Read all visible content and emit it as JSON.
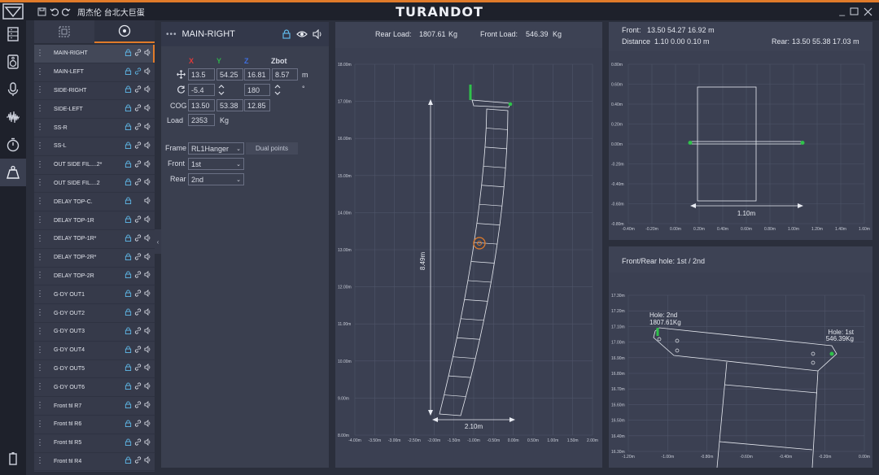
{
  "app": {
    "brand": "TURANDOT",
    "project_title": "周杰伦 台北大巨蛋"
  },
  "rail": {
    "items": [
      "speaker-stack-icon",
      "speaker-icon",
      "microphone-icon",
      "waveform-icon",
      "timer-icon",
      "weight-icon"
    ],
    "active_index": 5,
    "bottom_icon": "battery-icon"
  },
  "list": {
    "selected_index": 0,
    "items": [
      {
        "label": "MAIN-RIGHT",
        "lock": true,
        "link": true,
        "sound": true,
        "link_highlight": false
      },
      {
        "label": "MAIN-LEFT",
        "lock": true,
        "link": true,
        "sound": true,
        "link_highlight": true
      },
      {
        "label": "SIDE-RIGHT",
        "lock": true,
        "link": true,
        "sound": true,
        "link_highlight": false
      },
      {
        "label": "SIDE-LEFT",
        "lock": true,
        "link": true,
        "sound": true,
        "link_highlight": false
      },
      {
        "label": "SS-R",
        "lock": true,
        "link": true,
        "sound": true,
        "link_highlight": false
      },
      {
        "label": "SS-L",
        "lock": true,
        "link": true,
        "sound": true,
        "link_highlight": false
      },
      {
        "label": "OUT SIDE FIL....2*",
        "lock": true,
        "link": true,
        "sound": true,
        "link_highlight": false
      },
      {
        "label": "OUT SIDE FIL....2",
        "lock": true,
        "link": true,
        "sound": true,
        "link_highlight": false
      },
      {
        "label": "DELAY TOP-C.",
        "lock": true,
        "link": false,
        "sound": true,
        "link_highlight": false
      },
      {
        "label": "DELAY TOP-1R",
        "lock": true,
        "link": true,
        "sound": true,
        "link_highlight": false
      },
      {
        "label": "DELAY TOP-1R*",
        "lock": true,
        "link": true,
        "sound": true,
        "link_highlight": false
      },
      {
        "label": "DELAY TOP-2R*",
        "lock": true,
        "link": true,
        "sound": true,
        "link_highlight": false
      },
      {
        "label": "DELAY TOP-2R",
        "lock": true,
        "link": true,
        "sound": true,
        "link_highlight": false
      },
      {
        "label": "G-DY OUT1",
        "lock": true,
        "link": true,
        "sound": true,
        "link_highlight": false
      },
      {
        "label": "G-DY OUT2",
        "lock": true,
        "link": true,
        "sound": true,
        "link_highlight": false
      },
      {
        "label": "G-DY OUT3",
        "lock": true,
        "link": true,
        "sound": true,
        "link_highlight": false
      },
      {
        "label": "G-DY OUT4",
        "lock": true,
        "link": true,
        "sound": true,
        "link_highlight": false
      },
      {
        "label": "G-DY OUT5",
        "lock": true,
        "link": true,
        "sound": true,
        "link_highlight": false
      },
      {
        "label": "G-DY OUT6",
        "lock": true,
        "link": true,
        "sound": true,
        "link_highlight": false
      },
      {
        "label": "Front fil R7",
        "lock": true,
        "link": true,
        "sound": true,
        "link_highlight": false
      },
      {
        "label": "Front fil R6",
        "lock": true,
        "link": true,
        "sound": true,
        "link_highlight": false
      },
      {
        "label": "Front fil R5",
        "lock": true,
        "link": true,
        "sound": true,
        "link_highlight": false
      },
      {
        "label": "Front fil R4",
        "lock": true,
        "link": true,
        "sound": true,
        "link_highlight": false
      }
    ]
  },
  "props": {
    "title": "MAIN-RIGHT",
    "col_x": "X",
    "col_y": "Y",
    "col_z": "Z",
    "col_zbot": "Zbot",
    "pos": {
      "x": "13.5",
      "y": "54.25",
      "z": "16.81",
      "zbot": "8.57",
      "unit": "m"
    },
    "rot": {
      "a": "-5.4",
      "b": "180",
      "unit": "°"
    },
    "cog": {
      "label": "COG",
      "x": "13.50",
      "y": "53.38",
      "z": "12.85"
    },
    "load": {
      "label": "Load",
      "value": "2353",
      "unit": "Kg"
    },
    "frame": {
      "label": "Frame",
      "value": "RL1Hanger",
      "dual_points": "Dual points"
    },
    "front": {
      "label": "Front",
      "value": "1st"
    },
    "rear": {
      "label": "Rear",
      "value": "2nd"
    }
  },
  "side_view": {
    "rear_load_label": "Rear Load:",
    "rear_load_value": "1807.61",
    "front_load_label": "Front Load:",
    "front_load_value": "546.39",
    "load_unit": "Kg",
    "y_ticks": [
      "18.00m",
      "17.00m",
      "16.00m",
      "15.00m",
      "14.00m",
      "13.00m",
      "12.00m",
      "11.00m",
      "10.00m",
      "9.00m",
      "8.00m"
    ],
    "x_ticks": [
      "-4.00m",
      "-3.50m",
      "-3.00m",
      "-2.50m",
      "-2.00m",
      "-1.50m",
      "-1.00m",
      "-0.50m",
      "0.00m",
      "0.50m",
      "1.00m",
      "1.50m",
      "2.00m"
    ],
    "height_dim": "8.49m",
    "width_dim": "2.10m"
  },
  "front_view": {
    "front_label": "Front:",
    "front_values": "13.50 54.27 16.92 m",
    "distance_label": "Distance",
    "distance_values": "1.10 0.00 0.10 m",
    "rear_label": "Rear:",
    "rear_values": "13.50 55.38 17.03 m",
    "y_ticks": [
      "0.80m",
      "0.60m",
      "0.40m",
      "0.20m",
      "0.00m",
      "-0.20m",
      "-0.40m",
      "-0.60m",
      "-0.80m"
    ],
    "x_ticks": [
      "-0.40m",
      "-0.20m",
      "0.00m",
      "0.20m",
      "0.40m",
      "0.60m",
      "0.80m",
      "1.00m",
      "1.20m",
      "1.40m",
      "1.60m"
    ],
    "width_dim": "1.10m"
  },
  "hole_view": {
    "title": "Front/Rear hole: 1st / 2nd",
    "rear_hole_label": "Hole: 2nd",
    "rear_hole_load": "1807.61Kg",
    "front_hole_label": "Hole: 1st",
    "front_hole_load": "546.39Kg",
    "y_ticks": [
      "17.30m",
      "17.20m",
      "17.10m",
      "17.00m",
      "16.90m",
      "16.80m",
      "16.70m",
      "16.60m",
      "16.50m",
      "16.40m",
      "16.30m"
    ],
    "x_ticks": [
      "-1.20m",
      "-1.00m",
      "-0.80m",
      "-0.60m",
      "-0.40m",
      "-0.20m",
      "0.00m"
    ]
  },
  "colors": {
    "accent": "#e07b2a",
    "axis_x": "#e03a3a",
    "axis_y": "#2fb04a",
    "axis_z": "#3f6fe0",
    "link_highlight": "#5fb8e8",
    "point": "#2fc24a"
  }
}
